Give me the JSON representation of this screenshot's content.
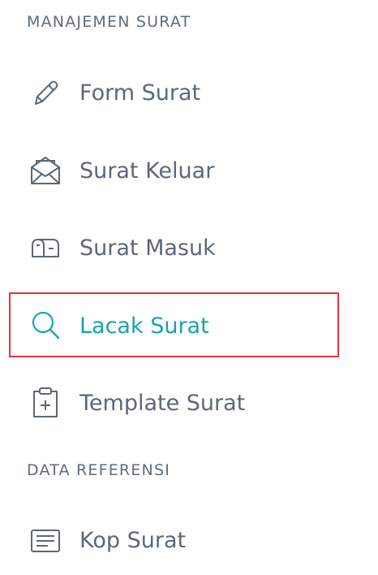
{
  "sections": [
    {
      "title": "MANAJEMEN SURAT",
      "items": [
        {
          "label": "Form Surat",
          "icon": "pencil-icon"
        },
        {
          "label": "Surat Keluar",
          "icon": "envelope-open-icon"
        },
        {
          "label": "Surat Masuk",
          "icon": "inbox-icon"
        },
        {
          "label": "Lacak Surat",
          "icon": "search-icon",
          "active": true
        },
        {
          "label": "Template Surat",
          "icon": "clipboard-plus-icon"
        }
      ]
    },
    {
      "title": "DATA REFERENSI",
      "items": [
        {
          "label": "Kop Surat",
          "icon": "document-lines-icon"
        }
      ]
    }
  ],
  "colors": {
    "text": "#5c6779",
    "section_title": "#5f6b80",
    "active": "#1aa3ac",
    "highlight_border": "#e8343c"
  }
}
